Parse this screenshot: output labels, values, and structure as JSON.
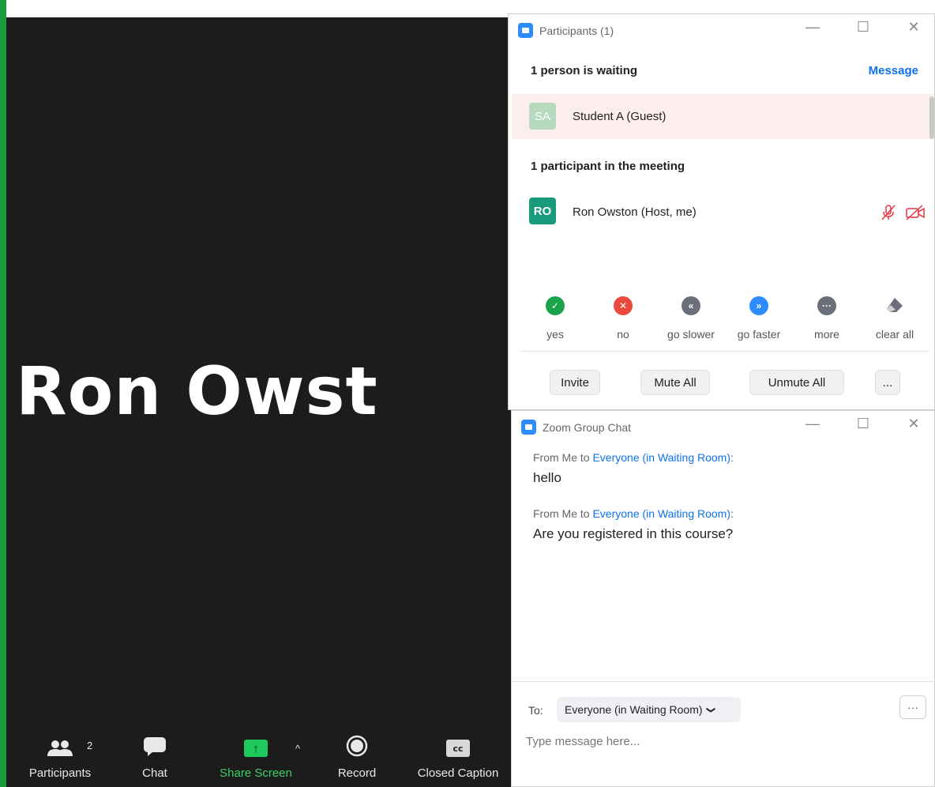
{
  "meeting": {
    "big_name": "Ron Owst",
    "toolbar": {
      "participants_label": "Participants",
      "participants_count": "2",
      "chat_label": "Chat",
      "share_label": "Share Screen",
      "record_label": "Record",
      "cc_label": "Closed Caption",
      "cc_icon_text": "cc"
    }
  },
  "participants": {
    "title": "Participants (1)",
    "waiting_heading": "1 person is waiting",
    "message_link": "Message",
    "waiting": [
      {
        "initials": "SA",
        "name": "Student A (Guest)"
      }
    ],
    "in_meeting_heading": "1 participant in the meeting",
    "in_meeting": [
      {
        "initials": "RO",
        "name": "Ron Owston (Host, me)"
      }
    ],
    "reactions": [
      {
        "label": "yes",
        "icon": "check-icon",
        "color": "#1aa34a"
      },
      {
        "label": "no",
        "icon": "x-icon",
        "color": "#e84a3c"
      },
      {
        "label": "go slower",
        "icon": "rewind-icon",
        "color": "#6a6f7a"
      },
      {
        "label": "go faster",
        "icon": "fast-forward-icon",
        "color": "#2d8cff"
      },
      {
        "label": "more",
        "icon": "more-dots-icon",
        "color": "#6a6f7a"
      },
      {
        "label": "clear all",
        "icon": "eraser-icon",
        "color": "#6a6f7a"
      }
    ],
    "buttons": {
      "invite": "Invite",
      "mute_all": "Mute All",
      "unmute_all": "Unmute All",
      "more": "..."
    }
  },
  "chat": {
    "title": "Zoom Group Chat",
    "messages": [
      {
        "prefix": "From Me to ",
        "to": "Everyone (in Waiting Room)",
        "suffix": ":",
        "text": "hello"
      },
      {
        "prefix": "From Me to ",
        "to": "Everyone (in Waiting Room)",
        "suffix": ":",
        "text": "Are you registered in this course?"
      }
    ],
    "to_label": "To:",
    "to_value": "Everyone (in Waiting Room)",
    "more": "···",
    "placeholder": "Type message here..."
  },
  "colors": {
    "frame_green": "#1a9a3c",
    "zoom_blue": "#2d8cff",
    "waiting_avatar": "#b7d9bd",
    "host_avatar": "#1a9a7c",
    "muted_red": "#e8343c"
  }
}
